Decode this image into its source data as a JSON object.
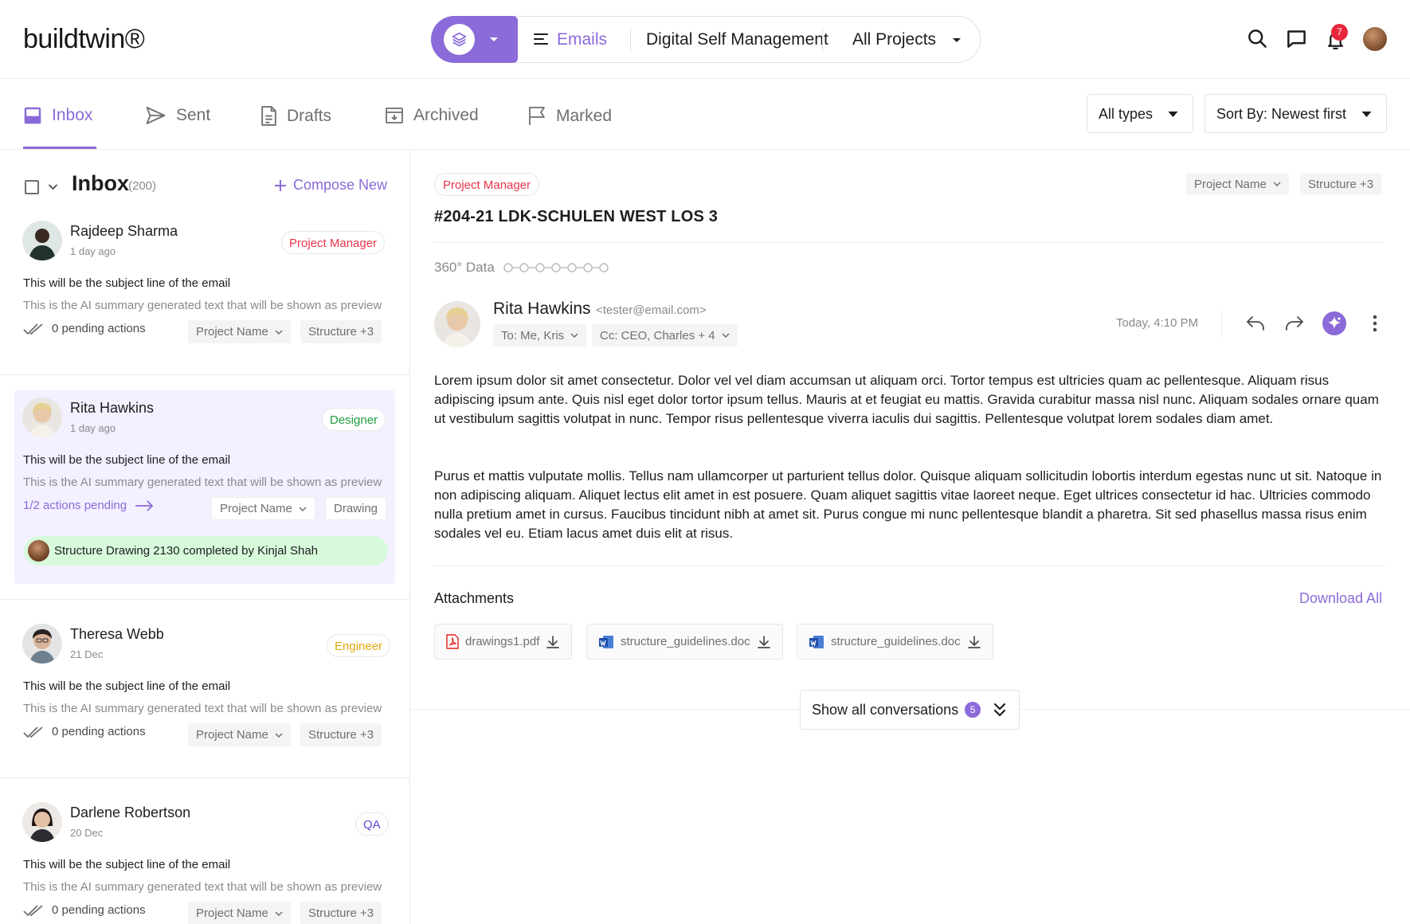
{
  "app": {
    "logo": "buildtwin®"
  },
  "switcher": {
    "module": "Emails",
    "project": "Digital Self Management",
    "scope": "All Projects"
  },
  "notifications": {
    "count": "7"
  },
  "tabs": [
    {
      "label": "Inbox",
      "icon": "inbox-icon"
    },
    {
      "label": "Sent",
      "icon": "send-icon"
    },
    {
      "label": "Drafts",
      "icon": "document-icon"
    },
    {
      "label": "Archived",
      "icon": "archive-icon"
    },
    {
      "label": "Marked",
      "icon": "flag-icon"
    }
  ],
  "filters": {
    "type": "All types",
    "sort": "Sort By: Newest first"
  },
  "list": {
    "title": "Inbox",
    "count": "(200)",
    "compose_label": "Compose New",
    "emails": [
      {
        "name": "Rajdeep Sharma",
        "time": "1 day ago",
        "role": "Project Manager",
        "role_color": "#e8334a",
        "subject": "This will be the subject line of the email",
        "preview": "This is the AI summary generated text that will be shown as preview",
        "pending": "0 pending actions",
        "chip1": "Project Name",
        "chip2": "Structure +3"
      },
      {
        "name": "Rita Hawkins",
        "time": "1 day ago",
        "role": "Designer",
        "role_color": "#1f9d3a",
        "subject": "This will be the subject line of the email",
        "preview": "This is the AI summary generated text that will be shown as preview",
        "pending": "1/2 actions pending",
        "chip1": "Project Name",
        "chip2": "Drawing",
        "completed": "Structure Drawing 2130 completed by Kinjal Shah",
        "selected": true
      },
      {
        "name": "Theresa Webb",
        "time": "21 Dec",
        "role": "Engineer",
        "role_color": "#e3a90a",
        "subject": "This will be the subject line of the email",
        "preview": "This is the AI summary generated text that will be shown as preview",
        "pending": "0 pending actions",
        "chip1": "Project Name",
        "chip2": "Structure +3"
      },
      {
        "name": "Darlene Robertson",
        "time": "20 Dec",
        "role": "QA",
        "role_color": "#5b49d6",
        "subject": "This will be the subject line of the email",
        "preview": "This is the AI summary generated text that will be shown as preview",
        "pending": "0 pending actions",
        "chip1": "Project Name",
        "chip2": "Structure +3"
      }
    ]
  },
  "detail": {
    "role": "Project Manager",
    "chip1": "Project Name",
    "chip2": "Structure +3",
    "title": "#204-21 LDK-SCHULEN WEST LOS 3",
    "data360": "360° Data",
    "sender_name": "Rita Hawkins",
    "sender_email": "<tester@email.com>",
    "to": "To: Me, Kris",
    "cc": "Cc: CEO, Charles + 4",
    "time": "Today, 4:10 PM",
    "body1": "Lorem ipsum dolor sit amet consectetur. Dolor vel vel diam accumsan ut aliquam orci. Tortor tempus est ultricies quam ac pellentesque. Aliquam risus adipiscing ipsum ante. Quis nisl eget dolor tortor ipsum tellus. Mauris at et feugiat eu mattis. Gravida curabitur massa nisl nunc. Aliquam sodales ornare quam ut vestibulum sagittis volutpat in nunc. Tempor risus pellentesque viverra iaculis dui sagittis. Pellentesque volutpat lorem sodales diam amet.",
    "body2": "Purus et mattis vulputate mollis. Tellus nam ullamcorper ut parturient tellus dolor. Quisque aliquam sollicitudin lobortis interdum egestas nunc ut sit. Natoque in non adipiscing aliquam. Aliquet lectus elit amet in est posuere. Quam aliquet sagittis vitae laoreet neque. Eget ultrices consectetur id hac. Ultricies commodo nulla pretium amet in cursus. Faucibus tincidunt nibh at amet sit. Purus congue mi nunc pellentesque blandit a pharetra. Sit sed phasellus massa risus enim sodales vel eu. Etiam lacus amet duis elit at risus.",
    "attachments_title": "Attachments",
    "download_all": "Download All",
    "attachments": [
      {
        "name": "drawings1.pdf",
        "icon": "pdf-icon"
      },
      {
        "name": "structure_guidelines.doc",
        "icon": "word-icon"
      },
      {
        "name": "structure_guidelines.doc",
        "icon": "word-icon"
      }
    ],
    "show_all": "Show all conversations",
    "show_all_count": "5"
  },
  "colors": {
    "accent": "#8b6ad9",
    "selected_bg": "#f3f0ff",
    "completed_bg": "#d7fadb"
  }
}
